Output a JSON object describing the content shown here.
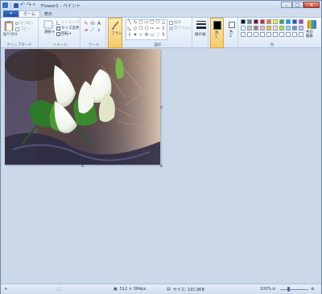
{
  "window": {
    "title": "Flower1 - ペイント"
  },
  "tabs": {
    "file": "▾",
    "home": "ホーム",
    "view": "表示"
  },
  "ribbon": {
    "clipboard": {
      "label": "クリップボード",
      "paste": "貼り付け",
      "cut": "切り取り",
      "copy": "コピー"
    },
    "image": {
      "label": "イメージ",
      "select": "選択",
      "crop": "トリミング",
      "resize": "サイズ変更",
      "rotate": "回転"
    },
    "tools": {
      "label": "ツール"
    },
    "brushes": {
      "label": "ブラシ"
    },
    "shapes": {
      "label": "図形",
      "outline": "輪郭",
      "fill": "塗りつぶし"
    },
    "size": {
      "label": "線の幅"
    },
    "color1": {
      "label": "色\n1"
    },
    "color2": {
      "label": "色\n2"
    },
    "colors": {
      "label": "色",
      "edit": "色の\n編集"
    }
  },
  "palette": {
    "row1": [
      "#000000",
      "#7f7f7f",
      "#880015",
      "#ed1c24",
      "#ff7f27",
      "#fff200",
      "#22b14c",
      "#00a2e8",
      "#3f48cc",
      "#a349a4"
    ],
    "row2": [
      "#ffffff",
      "#c3c3c3",
      "#b97a57",
      "#ffaec9",
      "#ffc90e",
      "#efe4b0",
      "#b5e61d",
      "#99d9ea",
      "#7092be",
      "#c8bfe7"
    ],
    "row3": [
      "#ffffff",
      "#ffffff",
      "#ffffff",
      "#ffffff",
      "#ffffff",
      "#ffffff",
      "#ffffff",
      "#ffffff",
      "#ffffff",
      "#ffffff"
    ],
    "color1_value": "#000000",
    "color2_value": "#ffffff"
  },
  "status": {
    "dimensions": "512 × 384px",
    "filesize": "サイズ: 191.9KB",
    "zoom": "100%"
  }
}
